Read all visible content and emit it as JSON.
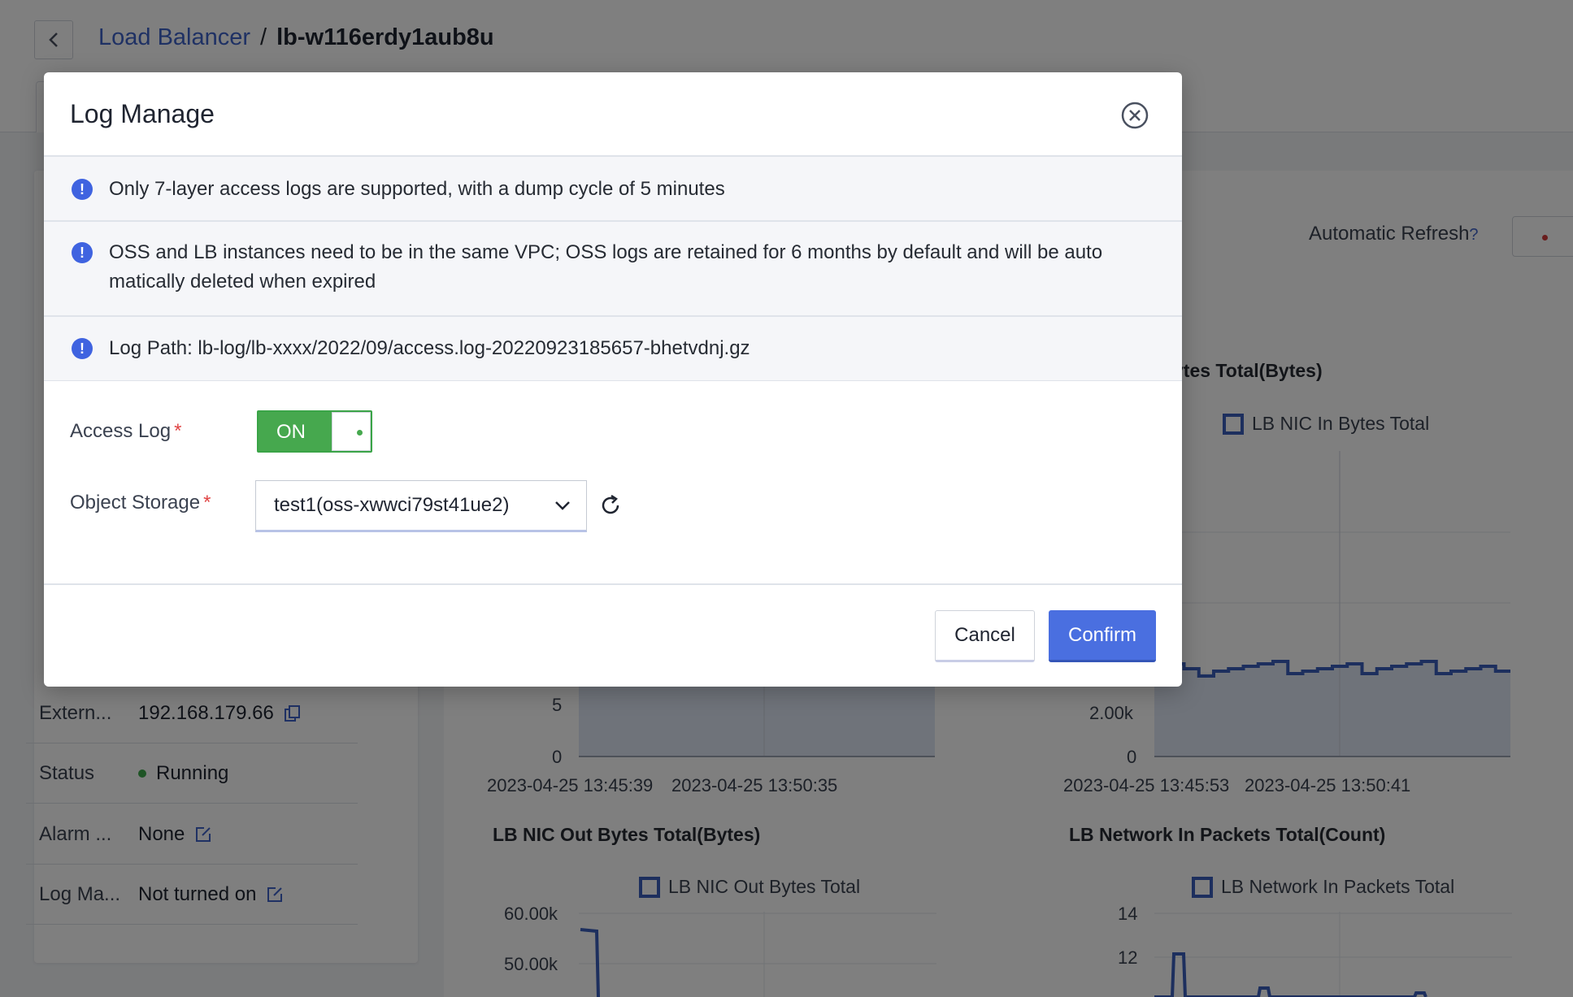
{
  "breadcrumb": {
    "parent": "Load Balancer",
    "separator": "/",
    "current": "lb-w116erdy1aub8u"
  },
  "details": [
    {
      "label": "Extern...",
      "value": "192.168.179.66"
    },
    {
      "label": "Status",
      "value": "Running"
    },
    {
      "label": "Alarm ...",
      "value": "None"
    },
    {
      "label": "Log Ma...",
      "value": "Not turned on"
    }
  ],
  "monitor": {
    "auto_refresh_label": "Automatic Refresh",
    "help_symbol": "?"
  },
  "chart_data": [
    {
      "type": "area",
      "title": "",
      "series": [
        {
          "name": ""
        }
      ],
      "y_ticks": [
        "5",
        "0"
      ],
      "x_ticks": [
        "2023-04-25 13:45:39",
        "2023-04-25 13:50:35"
      ]
    },
    {
      "type": "area",
      "title": "ytes Total(Bytes)",
      "series": [
        {
          "name": "LB NIC In Bytes Total",
          "values": [
            9.8,
            3.8,
            3.6,
            3.3,
            3.5,
            3.6,
            3.7,
            3.8,
            3.9,
            3.4,
            3.5,
            3.6,
            3.7,
            3.8,
            3.4,
            3.6,
            3.7,
            3.8,
            3.9,
            3.4,
            3.5,
            3.6,
            3.7,
            3.5
          ]
        }
      ],
      "y_ticks": [
        "2.00k",
        "0"
      ],
      "x_ticks": [
        "2023-04-25 13:45:53",
        "2023-04-25 13:50:41"
      ]
    },
    {
      "type": "area",
      "title": "LB NIC Out Bytes Total(Bytes)",
      "series": [
        {
          "name": "LB NIC Out Bytes Total"
        }
      ],
      "y_ticks": [
        "60.00k",
        "50.00k"
      ]
    },
    {
      "type": "area",
      "title": "LB Network In Packets Total(Count)",
      "series": [
        {
          "name": "LB Network In Packets Total"
        }
      ],
      "y_ticks": [
        "14",
        "12"
      ]
    }
  ],
  "modal": {
    "title": "Log Manage",
    "notices": [
      "Only 7-layer access logs are supported, with a dump cycle of 5 minutes",
      "OSS and LB instances need to be in the same VPC; OSS logs are retained for 6 months by default and will be auto matically deleted when expired",
      "Log Path: lb-log/lb-xxxx/2022/09/access.log-20220923185657-bhetvdnj.gz"
    ],
    "access_log_label": "Access Log",
    "required_mark": "*",
    "switch_text": "ON",
    "object_storage_label": "Object Storage",
    "object_storage_value": "test1(oss-xwwci79st41ue2)",
    "cancel_label": "Cancel",
    "confirm_label": "Confirm"
  },
  "colors": {
    "accent": "#4a6fe0",
    "switch_on": "#46a84e",
    "series": "#3a5fbd"
  }
}
